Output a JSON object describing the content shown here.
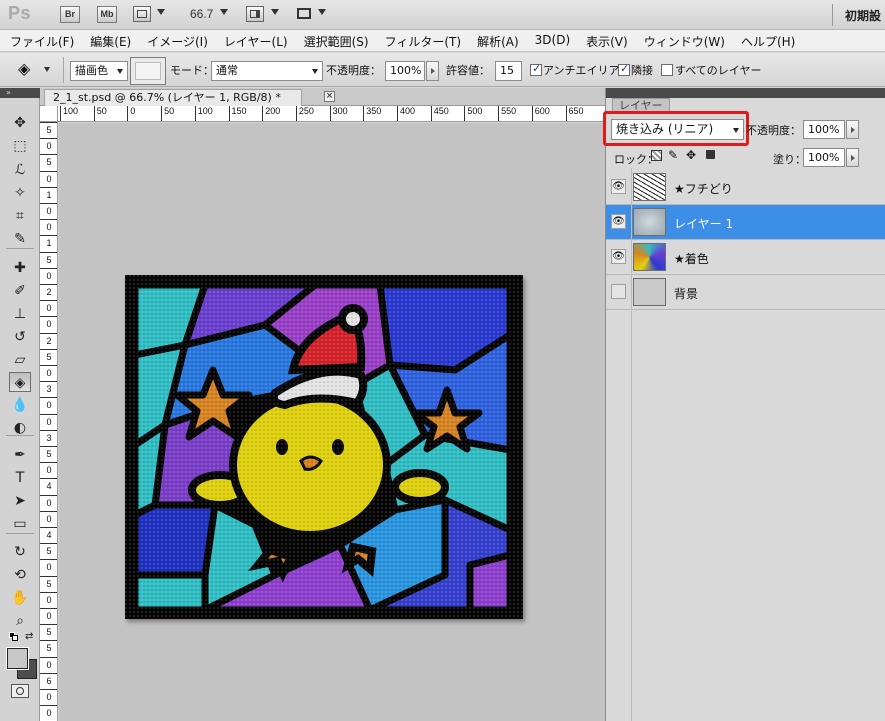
{
  "app": {
    "logo": "Ps",
    "bridge_label": "Br",
    "minibridge_label": "Mb",
    "zoom_value": "66.7",
    "workspace_label": "初期設"
  },
  "menu": {
    "items": [
      "ファイル(F)",
      "編集(E)",
      "イメージ(I)",
      "レイヤー(L)",
      "選択範囲(S)",
      "フィルター(T)",
      "解析(A)",
      "3D(D)",
      "表示(V)",
      "ウィンドウ(W)",
      "ヘルプ(H)"
    ]
  },
  "options": {
    "fill_source": "描画色",
    "mode_label": "モード：",
    "mode_value": "通常",
    "opacity_label": "不透明度：",
    "opacity_value": "100%",
    "tolerance_label": "許容値：",
    "tolerance_value": "15",
    "antialias_label": "アンチエイリアス",
    "antialias_checked": true,
    "contiguous_label": "隣接",
    "contiguous_checked": true,
    "all_layers_label": "すべてのレイヤー",
    "all_layers_checked": false
  },
  "document": {
    "tab_title": "2_1_st.psd @ 66.7% (レイヤー 1, RGB/8) *",
    "close_label": "×"
  },
  "rulers": {
    "horizontal": [
      "100",
      "50",
      "0",
      "50",
      "100",
      "150",
      "200",
      "250",
      "300",
      "350",
      "400",
      "450",
      "500",
      "550",
      "600",
      "650"
    ],
    "vertical": [
      "5",
      "0",
      "5",
      "0",
      "1",
      "0",
      "0",
      "1",
      "5",
      "0",
      "2",
      "0",
      "0",
      "2",
      "5",
      "0",
      "3",
      "0",
      "0",
      "3",
      "5",
      "0",
      "4",
      "0",
      "0",
      "4",
      "5",
      "0",
      "5",
      "0",
      "0",
      "5",
      "5",
      "0",
      "6",
      "0",
      "0"
    ]
  },
  "tools": [
    {
      "name": "move-tool",
      "glyph": "✥"
    },
    {
      "name": "marquee-tool",
      "glyph": "⬚"
    },
    {
      "name": "lasso-tool",
      "glyph": "ℒ"
    },
    {
      "name": "quick-select-tool",
      "glyph": "✧"
    },
    {
      "name": "crop-tool",
      "glyph": "⌗"
    },
    {
      "name": "eyedropper-tool",
      "glyph": "✎"
    },
    {
      "name": "healing-brush-tool",
      "glyph": "✚"
    },
    {
      "name": "brush-tool",
      "glyph": "✐"
    },
    {
      "name": "clone-stamp-tool",
      "glyph": "⊥"
    },
    {
      "name": "history-brush-tool",
      "glyph": "↺"
    },
    {
      "name": "eraser-tool",
      "glyph": "▱"
    },
    {
      "name": "paint-bucket-tool",
      "glyph": "◈"
    },
    {
      "name": "blur-tool",
      "glyph": "💧"
    },
    {
      "name": "dodge-tool",
      "glyph": "◐"
    },
    {
      "name": "pen-tool",
      "glyph": "✒"
    },
    {
      "name": "type-tool",
      "glyph": "T"
    },
    {
      "name": "path-select-tool",
      "glyph": "➤"
    },
    {
      "name": "shape-tool",
      "glyph": "▭"
    },
    {
      "name": "3d-rotate-tool",
      "glyph": "↻"
    },
    {
      "name": "3d-orbit-tool",
      "glyph": "⟲"
    },
    {
      "name": "hand-tool",
      "glyph": "✋"
    },
    {
      "name": "zoom-tool",
      "glyph": "⌕"
    }
  ],
  "layers_panel": {
    "tab_label": "レイヤー",
    "blend_mode": "焼き込み (リニア)",
    "opacity_label": "不透明度：",
    "opacity_value": "100%",
    "lock_label": "ロック：",
    "fill_label": "塗り：",
    "fill_value": "100%",
    "layers": [
      {
        "name": "★フチどり",
        "visible": true,
        "selected": false
      },
      {
        "name": "レイヤー 1",
        "visible": true,
        "selected": true
      },
      {
        "name": "★着色",
        "visible": true,
        "selected": false
      },
      {
        "name": "背景",
        "visible": false,
        "selected": false
      }
    ]
  },
  "colors": {
    "accent_selected": "#3d8ee6",
    "highlight_box": "#e01b1b"
  }
}
